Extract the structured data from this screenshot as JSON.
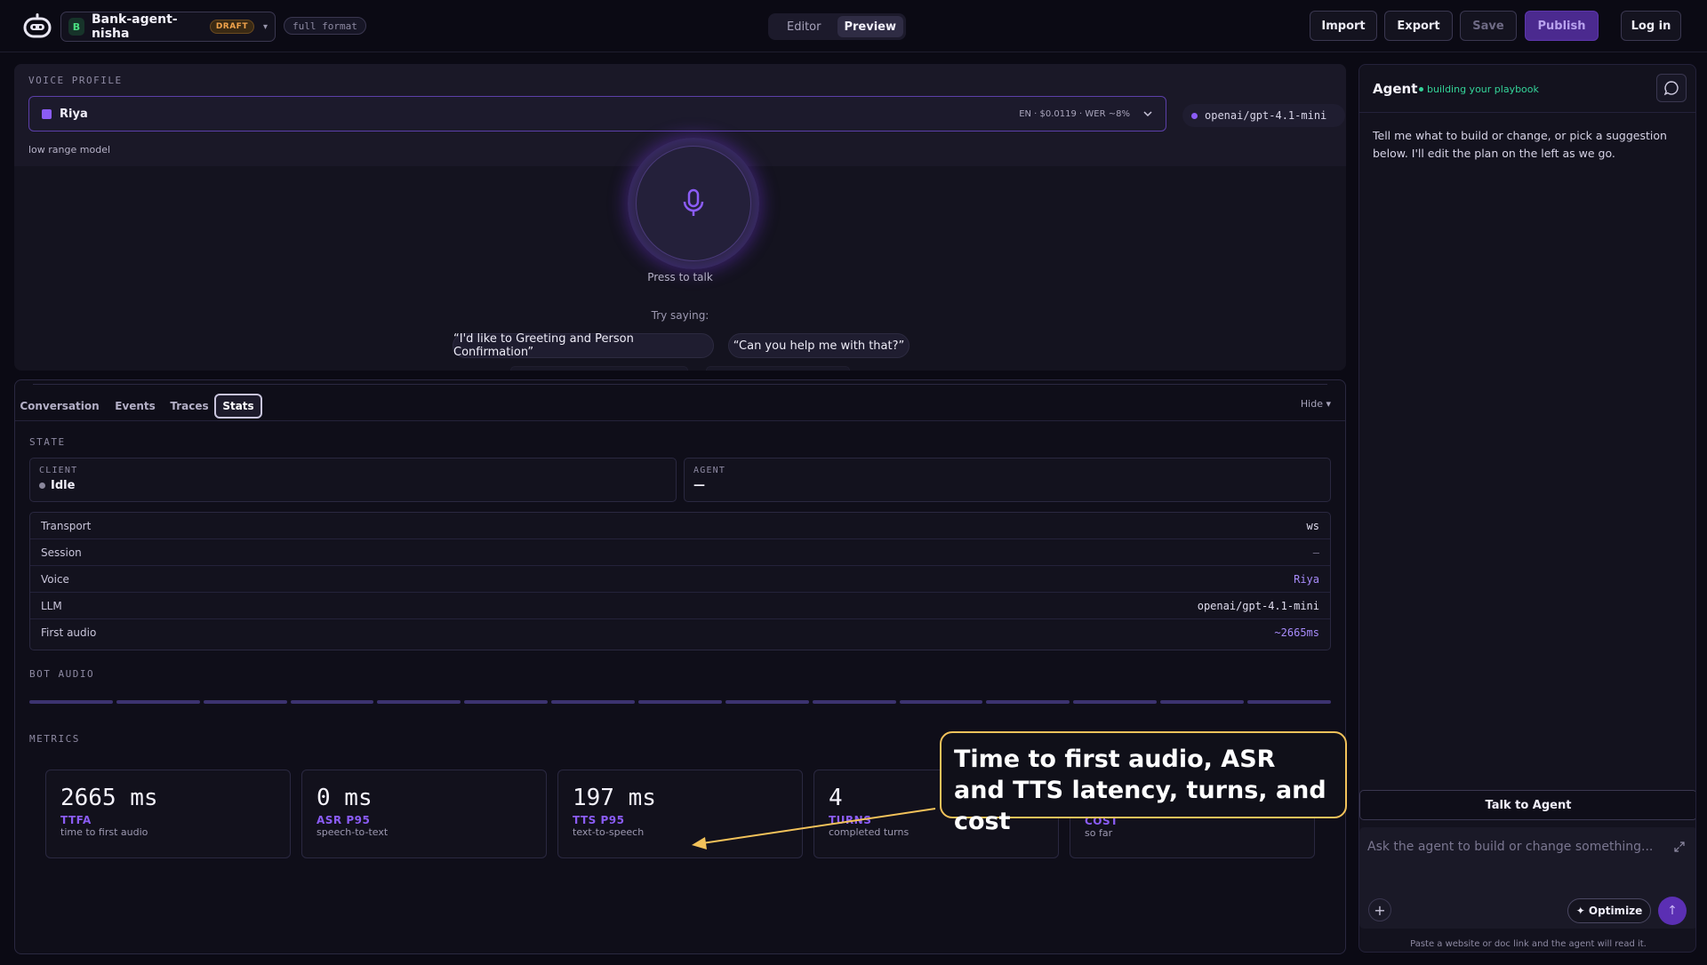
{
  "header": {
    "agent_initial": "B",
    "agent_name": "Bank-agent-nisha",
    "draft_label": "DRAFT",
    "caret": "▾",
    "format_label": "full format",
    "modes": [
      "Editor",
      "Preview"
    ],
    "active_mode": "Preview",
    "import_label": "Import",
    "export_label": "Export",
    "save_label": "Save",
    "publish_label": "Publish",
    "login_label": "Log in"
  },
  "voice_profile": {
    "section_label": "VOICE PROFILE",
    "voice_name": "Riya",
    "voice_meta": "EN · $0.0119 · WER ~8%",
    "model": "openai/gpt-4.1-mini",
    "range_note": "low range model",
    "press_to_talk": "Press to talk",
    "try_saying": "Try saying:",
    "suggestions": [
      "“I'd like to Greeting and Person Confirmation”",
      "“Can you help me with that?”"
    ]
  },
  "stats": {
    "tabs": [
      "Conversation",
      "Events",
      "Traces",
      "Stats"
    ],
    "active_tab": "Stats",
    "hide_label": "Hide ▾",
    "state_label": "STATE",
    "client_cap": "CLIENT",
    "client_val": "Idle",
    "agent_cap": "AGENT",
    "agent_val": "—",
    "rows": [
      {
        "key": "Transport",
        "val": "ws"
      },
      {
        "key": "Session",
        "val": "–"
      },
      {
        "key": "Voice",
        "val": "Riya"
      },
      {
        "key": "LLM",
        "val": "openai/gpt-4.1-mini"
      },
      {
        "key": "First audio",
        "val": "~2665ms"
      }
    ],
    "bot_audio_label": "BOT AUDIO",
    "metrics_label": "METRICS",
    "metrics": [
      {
        "value": "2665 ms",
        "name": "TTFA",
        "sub": "time to first audio"
      },
      {
        "value": "0 ms",
        "name": "ASR P95",
        "sub": "speech-to-text"
      },
      {
        "value": "197 ms",
        "name": "TTS P95",
        "sub": "text-to-speech"
      },
      {
        "value": "4",
        "name": "TURNS",
        "sub": "completed turns"
      },
      {
        "value": "",
        "name": "COST",
        "sub": "so far"
      }
    ]
  },
  "callout": {
    "text": "Time to first audio, ASR and TTS latency, turns, and cost"
  },
  "agent_panel": {
    "title": "Agent",
    "status": "building your playbook",
    "intro": "Tell me what to build or change, or pick a suggestion below. I'll edit the plan on the left as we go.",
    "talk_button": "Talk to Agent",
    "composer_placeholder": "Ask the agent to build or change something...",
    "plus_label": "+",
    "optimize_label": "✦ Optimize",
    "send_label": "↑",
    "paste_note": "Paste a website or doc link and the agent will read it."
  },
  "colors": {
    "accent": "#8b5cf6",
    "callout_border": "#f2c25a",
    "status_green": "#34d399",
    "draft_orange": "#f0a34b"
  }
}
